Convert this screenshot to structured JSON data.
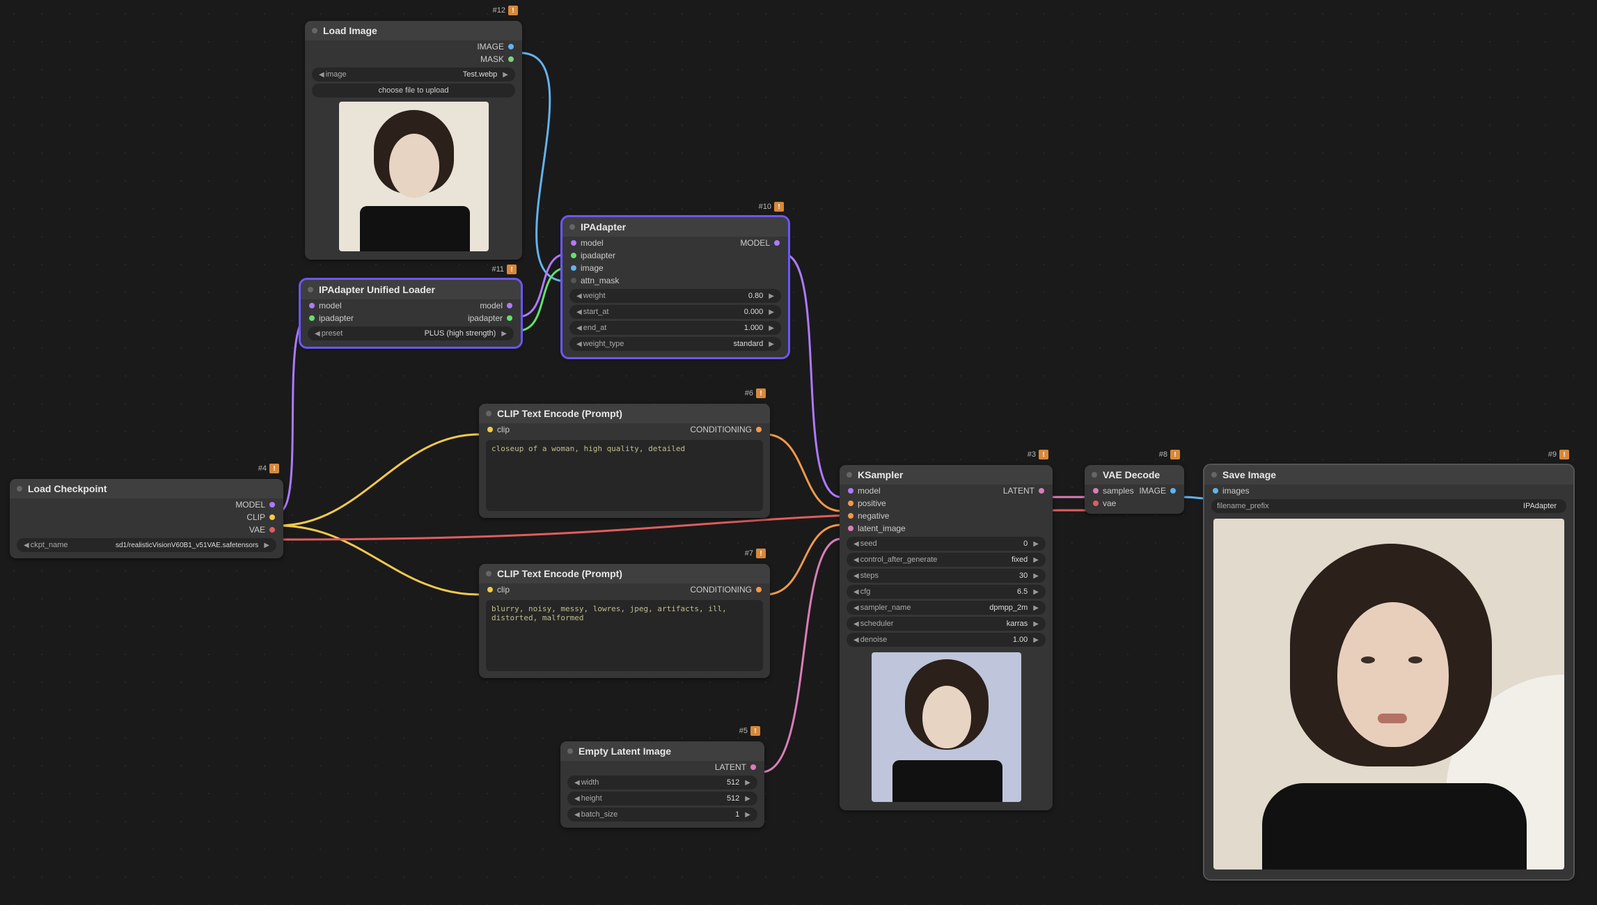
{
  "badges": {
    "load_image": "#12",
    "ip_unified": "#11",
    "ipadapter": "#10",
    "clip_pos": "#6",
    "clip_neg": "#7",
    "load_ckpt": "#4",
    "empty_latent": "#5",
    "ksampler": "#3",
    "vae_decode": "#8",
    "save_image": "#9"
  },
  "nodes": {
    "load_image": {
      "title": "Load Image",
      "outputs": {
        "image": "IMAGE",
        "mask": "MASK"
      },
      "widgets": {
        "image_label": "image",
        "image_value": "Test.webp",
        "upload": "choose file to upload"
      }
    },
    "ip_unified": {
      "title": "IPAdapter Unified Loader",
      "inputs": {
        "model": "model",
        "ipadapter": "ipadapter"
      },
      "outputs": {
        "model": "model",
        "ipadapter": "ipadapter"
      },
      "widgets": {
        "preset_label": "preset",
        "preset_value": "PLUS (high strength)"
      }
    },
    "ipadapter": {
      "title": "IPAdapter",
      "inputs": {
        "model": "model",
        "ipadapter": "ipadapter",
        "image": "image",
        "attn_mask": "attn_mask"
      },
      "outputs": {
        "model": "MODEL"
      },
      "widgets": {
        "weight_label": "weight",
        "weight_value": "0.80",
        "start_at_label": "start_at",
        "start_at_value": "0.000",
        "end_at_label": "end_at",
        "end_at_value": "1.000",
        "weight_type_label": "weight_type",
        "weight_type_value": "standard"
      }
    },
    "clip_pos": {
      "title": "CLIP Text Encode (Prompt)",
      "inputs": {
        "clip": "clip"
      },
      "outputs": {
        "cond": "CONDITIONING"
      },
      "text": "closeup of a woman, high quality, detailed"
    },
    "clip_neg": {
      "title": "CLIP Text Encode (Prompt)",
      "inputs": {
        "clip": "clip"
      },
      "outputs": {
        "cond": "CONDITIONING"
      },
      "text": "blurry, noisy, messy, lowres, jpeg, artifacts, ill, distorted, malformed"
    },
    "load_ckpt": {
      "title": "Load Checkpoint",
      "outputs": {
        "model": "MODEL",
        "clip": "CLIP",
        "vae": "VAE"
      },
      "widgets": {
        "ckpt_label": "ckpt_name",
        "ckpt_value": "sd1/realisticVisionV60B1_v51VAE.safetensors"
      }
    },
    "empty_latent": {
      "title": "Empty Latent Image",
      "outputs": {
        "latent": "LATENT"
      },
      "widgets": {
        "width_label": "width",
        "width_value": "512",
        "height_label": "height",
        "height_value": "512",
        "batch_label": "batch_size",
        "batch_value": "1"
      }
    },
    "ksampler": {
      "title": "KSampler",
      "inputs": {
        "model": "model",
        "positive": "positive",
        "negative": "negative",
        "latent_image": "latent_image"
      },
      "outputs": {
        "latent": "LATENT"
      },
      "widgets": {
        "seed_label": "seed",
        "seed_value": "0",
        "control_label": "control_after_generate",
        "control_value": "fixed",
        "steps_label": "steps",
        "steps_value": "30",
        "cfg_label": "cfg",
        "cfg_value": "6.5",
        "sampler_label": "sampler_name",
        "sampler_value": "dpmpp_2m",
        "scheduler_label": "scheduler",
        "scheduler_value": "karras",
        "denoise_label": "denoise",
        "denoise_value": "1.00"
      }
    },
    "vae_decode": {
      "title": "VAE Decode",
      "inputs": {
        "samples": "samples",
        "vae": "vae"
      },
      "outputs": {
        "image": "IMAGE"
      }
    },
    "save_image": {
      "title": "Save Image",
      "inputs": {
        "images": "images"
      },
      "widgets": {
        "prefix_label": "filename_prefix",
        "prefix_value": "IPAdapter"
      }
    }
  },
  "colors": {
    "model": "#ae7aff",
    "clip": "#f2c94c",
    "vae": "#e05d5d",
    "image": "#63b3ed",
    "latent": "#d97eb8",
    "cond": "#f2994a",
    "ipadapter": "#63e06e",
    "mask": "#7fd17f"
  }
}
